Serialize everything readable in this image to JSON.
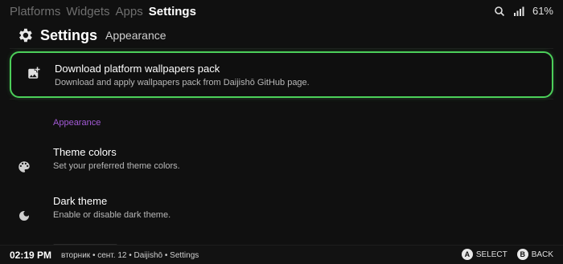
{
  "topnav": {
    "tabs": [
      {
        "label": "Platforms",
        "active": false
      },
      {
        "label": "Widgets",
        "active": false
      },
      {
        "label": "Apps",
        "active": false
      },
      {
        "label": "Settings",
        "active": true
      }
    ],
    "status": {
      "battery": "61%",
      "icons": [
        "search-icon",
        "signal-icon"
      ]
    }
  },
  "header": {
    "icon": "gear-icon",
    "title": "Settings",
    "subtitle": "Appearance"
  },
  "items": {
    "download": {
      "icon": "add-photo-icon",
      "title": "Download platform wallpapers pack",
      "subtitle": "Download and apply wallpapers pack from Daijishō GitHub page."
    },
    "section_label": "Appearance",
    "theme_colors": {
      "icon": "palette-icon",
      "title": "Theme colors",
      "subtitle": "Set your preferred theme colors."
    },
    "dark_theme": {
      "icon": "moon-icon",
      "title": "Dark theme",
      "subtitle": "Enable or disable dark theme."
    }
  },
  "footer": {
    "time": "02:19 PM",
    "info": "вторник • сент. 12 • Daijishō • Settings",
    "actions": [
      {
        "key": "A",
        "label": "SELECT"
      },
      {
        "key": "B",
        "label": "BACK"
      }
    ]
  },
  "colors": {
    "highlight": "#4ccf5a",
    "section": "#a35ad6",
    "background": "#101010"
  }
}
